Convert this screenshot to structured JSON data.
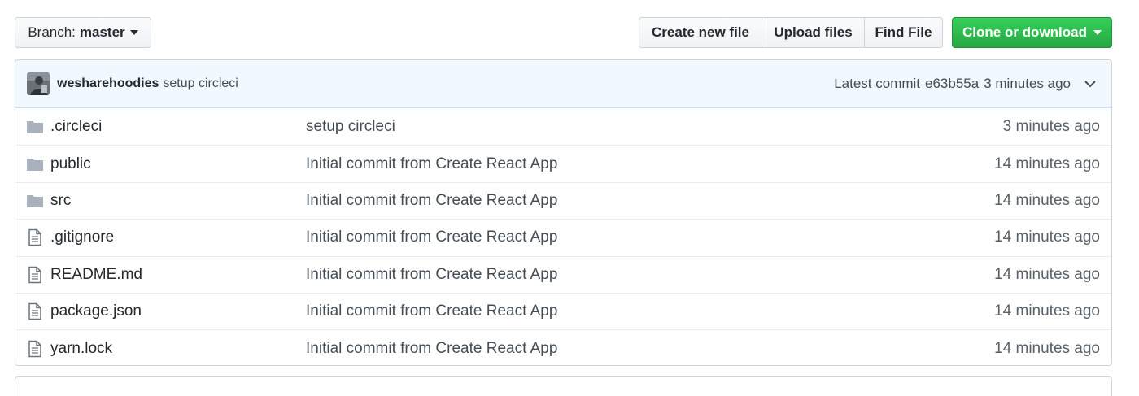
{
  "branch": {
    "prefix": "Branch:",
    "name": "master"
  },
  "actions": {
    "create_new_file": "Create new file",
    "upload_files": "Upload files",
    "find_file": "Find File",
    "clone_or_download": "Clone or download"
  },
  "commit": {
    "author": "wesharehoodies",
    "message": "setup circleci",
    "latest_label": "Latest commit",
    "sha": "e63b55a",
    "when": "3 minutes ago"
  },
  "files": [
    {
      "type": "folder",
      "icon": "folder-icon",
      "name": ".circleci",
      "message": "setup circleci",
      "age": "3 minutes ago"
    },
    {
      "type": "folder",
      "icon": "folder-icon",
      "name": "public",
      "message": "Initial commit from Create React App",
      "age": "14 minutes ago"
    },
    {
      "type": "folder",
      "icon": "folder-icon",
      "name": "src",
      "message": "Initial commit from Create React App",
      "age": "14 minutes ago"
    },
    {
      "type": "file",
      "icon": "file-icon",
      "name": ".gitignore",
      "message": "Initial commit from Create React App",
      "age": "14 minutes ago"
    },
    {
      "type": "file",
      "icon": "file-icon",
      "name": "README.md",
      "message": "Initial commit from Create React App",
      "age": "14 minutes ago"
    },
    {
      "type": "file",
      "icon": "file-icon",
      "name": "package.json",
      "message": "Initial commit from Create React App",
      "age": "14 minutes ago"
    },
    {
      "type": "file",
      "icon": "file-icon",
      "name": "yarn.lock",
      "message": "Initial commit from Create React App",
      "age": "14 minutes ago"
    }
  ],
  "colors": {
    "clone_button": "#28a745",
    "commit_bar": "#f1f8ff",
    "folder_icon": "#a9b2bc",
    "file_icon": "#6a737d"
  }
}
